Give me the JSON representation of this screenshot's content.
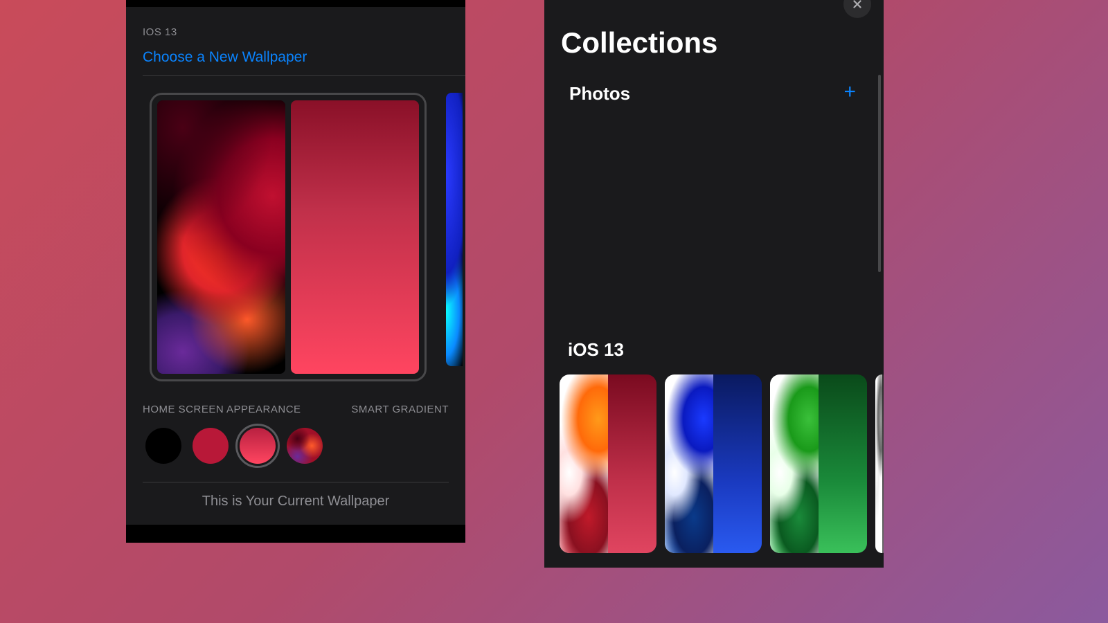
{
  "left": {
    "section": "IOS 13",
    "choose": "Choose a New Wallpaper",
    "appearance_label": "HOME SCREEN APPEARANCE",
    "smart_gradient": "SMART GRADIENT",
    "current": "This is Your Current Wallpaper"
  },
  "right": {
    "title": "Collections",
    "photos": "Photos",
    "ios13": "iOS 13"
  }
}
